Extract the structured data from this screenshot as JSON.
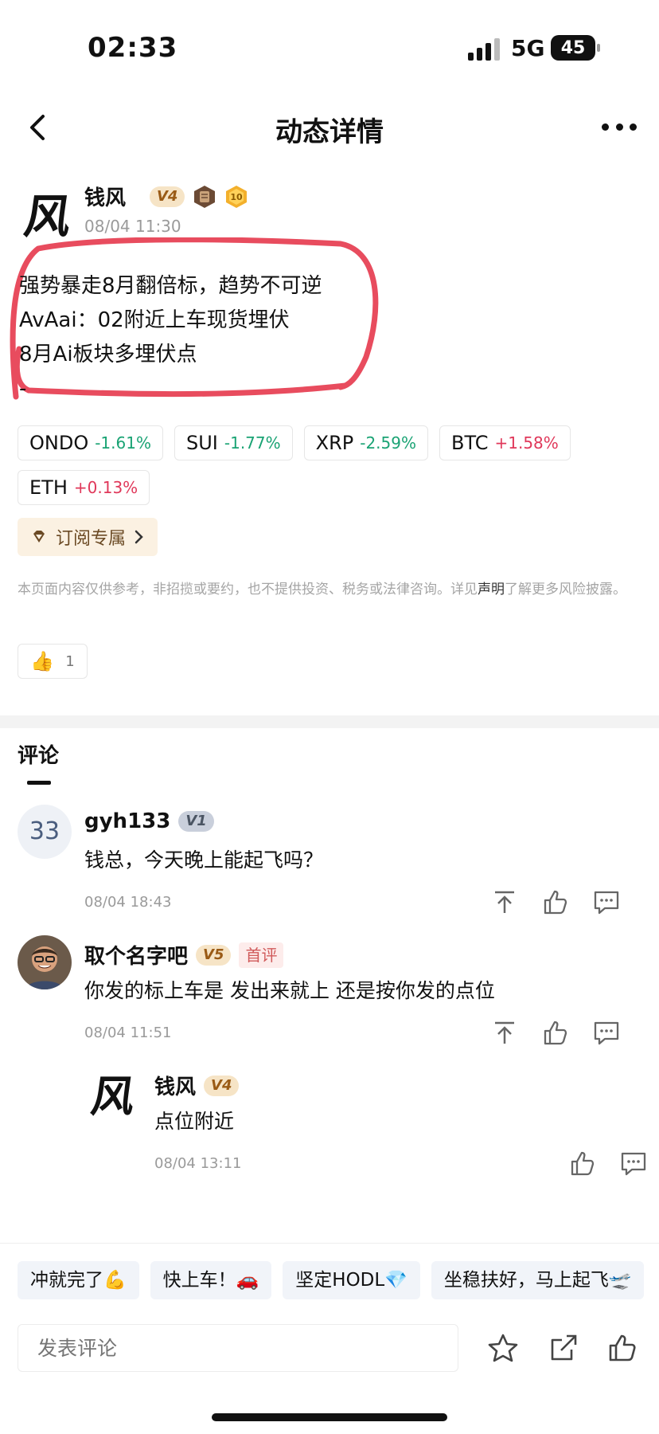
{
  "status_bar": {
    "time": "02:33",
    "network": "5G",
    "battery": "45"
  },
  "nav": {
    "title": "动态详情"
  },
  "post": {
    "author_avatar_glyph": "风",
    "author": "钱风",
    "author_level": "V4",
    "rank_number": "10",
    "time": "08/04 11:30",
    "lines": [
      "强势暴走8月翻倍标，趋势不可逆",
      "AvAai：02附近上车现货埋伏",
      "8月Ai板块多埋伏点",
      "-"
    ],
    "tickers": [
      {
        "symbol": "ONDO",
        "change": "-1.61%",
        "direction": "down"
      },
      {
        "symbol": "SUI",
        "change": "-1.77%",
        "direction": "down"
      },
      {
        "symbol": "XRP",
        "change": "-2.59%",
        "direction": "down"
      },
      {
        "symbol": "BTC",
        "change": "+1.58%",
        "direction": "up"
      },
      {
        "symbol": "ETH",
        "change": "+0.13%",
        "direction": "up"
      }
    ],
    "subscribe_label": "订阅专属",
    "disclaimer_before": "本页面内容仅供参考，非招揽或要约，也不提供投资、税务或法律咨询。详见",
    "disclaimer_link": "声明",
    "disclaimer_after": "了解更多风险披露。",
    "like_emoji": "👍",
    "like_count": "1"
  },
  "comments": {
    "title": "评论",
    "items": [
      {
        "avatar_text": "33",
        "user": "gyh133",
        "level": "V1",
        "text": "钱总，今天晚上能起飞吗？",
        "time": "08/04 18:43"
      },
      {
        "user": "取个名字吧",
        "level": "V5",
        "first_tag": "首评",
        "text": "你发的标上车是 发出来就上 还是按你发的点位",
        "time": "08/04 11:51"
      }
    ],
    "reply": {
      "avatar_glyph": "风",
      "user": "钱风",
      "level": "V4",
      "text": "点位附近",
      "time": "08/04 13:11"
    }
  },
  "quick_replies": [
    "冲就完了💪",
    "快上车！🚗",
    "坚定HODL💎",
    "坐稳扶好，马上起飞🛫"
  ],
  "input": {
    "placeholder": "发表评论"
  },
  "colors": {
    "up": "#e0385a",
    "down": "#1aa374",
    "highlight": "#e5394d"
  }
}
